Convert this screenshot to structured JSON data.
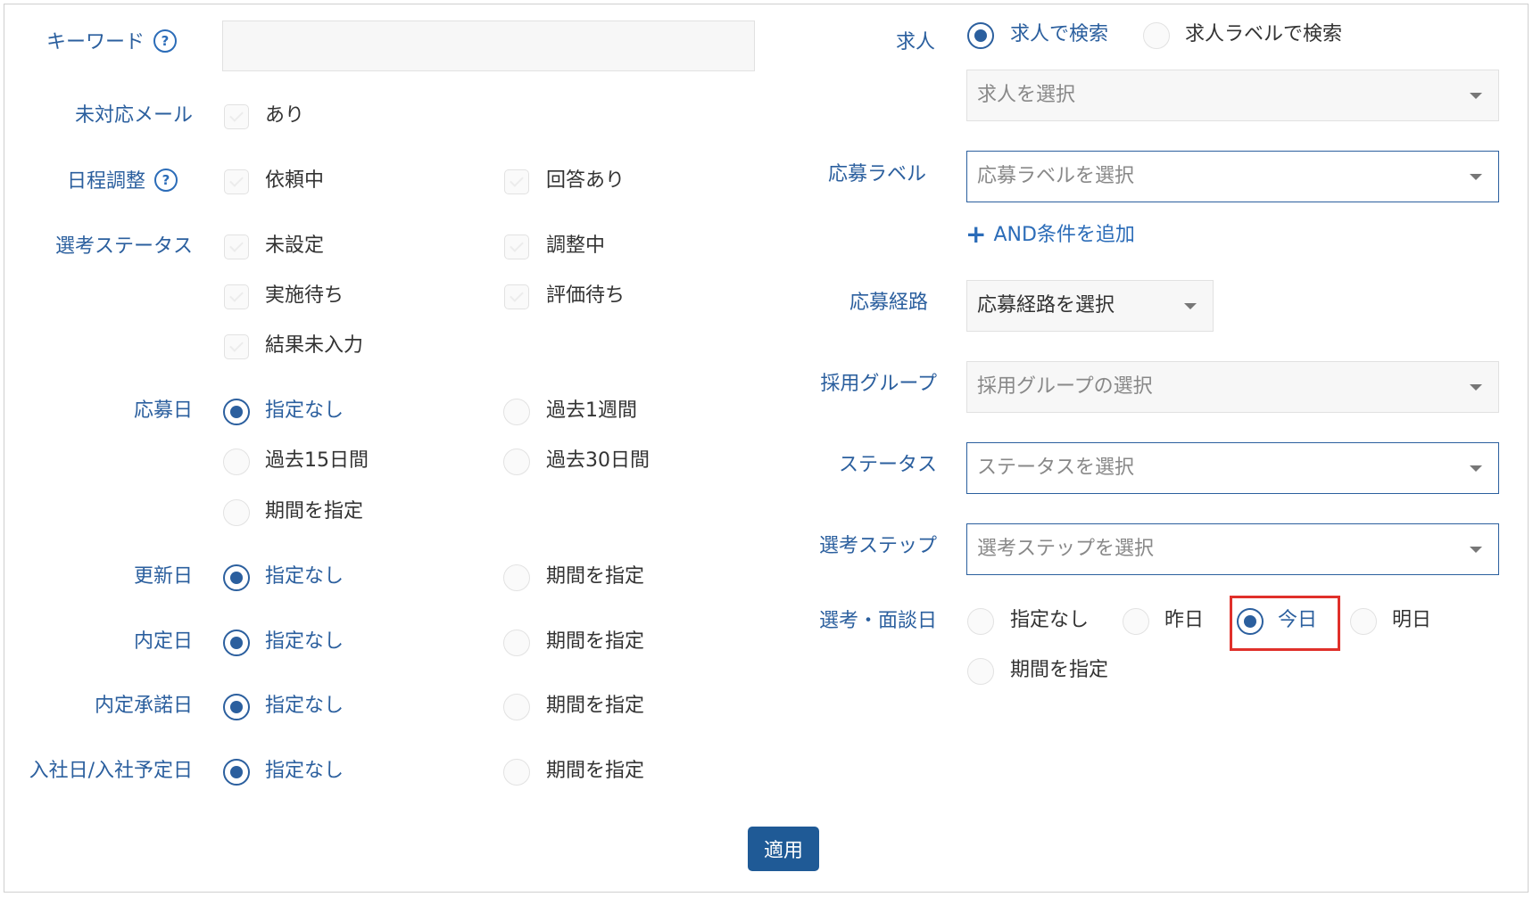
{
  "left": {
    "keyword": {
      "label": "キーワード",
      "value": ""
    },
    "unread_mail": {
      "label": "未対応メール",
      "options": [
        "あり"
      ]
    },
    "schedule": {
      "label": "日程調整",
      "options": [
        "依頼中",
        "回答あり"
      ]
    },
    "selection_status": {
      "label": "選考ステータス",
      "options": [
        "未設定",
        "調整中",
        "実施待ち",
        "評価待ち",
        "結果未入力"
      ]
    },
    "apply_date": {
      "label": "応募日",
      "options": [
        "指定なし",
        "過去1週間",
        "過去15日間",
        "過去30日間",
        "期間を指定"
      ],
      "selected": "指定なし"
    },
    "update_date": {
      "label": "更新日",
      "options": [
        "指定なし",
        "期間を指定"
      ],
      "selected": "指定なし"
    },
    "offer_date": {
      "label": "内定日",
      "options": [
        "指定なし",
        "期間を指定"
      ],
      "selected": "指定なし"
    },
    "offer_accept_date": {
      "label": "内定承諾日",
      "options": [
        "指定なし",
        "期間を指定"
      ],
      "selected": "指定なし"
    },
    "join_date": {
      "label": "入社日/入社予定日",
      "options": [
        "指定なし",
        "期間を指定"
      ],
      "selected": "指定なし"
    }
  },
  "right": {
    "job": {
      "label": "求人",
      "options": [
        "求人で検索",
        "求人ラベルで検索"
      ],
      "selected": "求人で検索",
      "placeholder": "求人を選択"
    },
    "apply_label": {
      "label": "応募ラベル",
      "placeholder": "応募ラベルを選択",
      "add_link": "AND条件を追加"
    },
    "apply_route": {
      "label": "応募経路",
      "placeholder": "応募経路を選択"
    },
    "hiring_group": {
      "label": "採用グループ",
      "placeholder": "採用グループの選択"
    },
    "status": {
      "label": "ステータス",
      "placeholder": "ステータスを選択"
    },
    "selection_step": {
      "label": "選考ステップ",
      "placeholder": "選考ステップを選択"
    },
    "interview_date": {
      "label": "選考・面談日",
      "options": [
        "指定なし",
        "昨日",
        "今日",
        "明日",
        "期間を指定"
      ],
      "selected": "今日"
    }
  },
  "apply_button": "適用",
  "colors": {
    "accent": "#2b5f9e",
    "button": "#1f5a96",
    "highlight": "#e0302a"
  },
  "icons": {
    "help": "question-circle-icon",
    "add": "plus-icon",
    "dropdown": "caret-down-icon"
  }
}
